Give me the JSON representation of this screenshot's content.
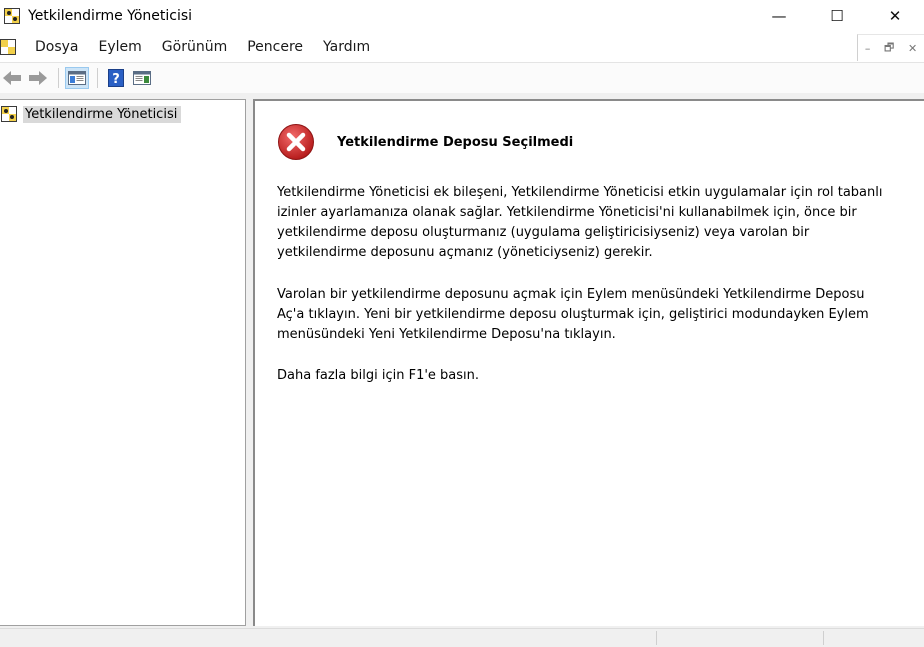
{
  "window": {
    "title": "Yetkilendirme Yöneticisi",
    "controls": {
      "minimize": "—",
      "maximize": "☐",
      "close": "✕"
    }
  },
  "menu": {
    "items": [
      "Dosya",
      "Eylem",
      "Görünüm",
      "Pencere",
      "Yardım"
    ]
  },
  "mdi_controls": {
    "minimize": "–",
    "restore": "🗗",
    "close": "✕"
  },
  "toolbar": {
    "buttons": [
      "back-icon",
      "forward-icon",
      "show-hide-console-tree-icon",
      "help-icon",
      "show-hide-action-pane-icon"
    ]
  },
  "tree": {
    "root_label": "Yetkilendirme Yöneticisi"
  },
  "content": {
    "heading": "Yetkilendirme Deposu Seçilmedi",
    "paragraph1": "Yetkilendirme Yöneticisi ek bileşeni, Yetkilendirme Yöneticisi etkin uygulamalar için rol tabanlı izinler ayarlamanıza olanak sağlar. Yetkilendirme Yöneticisi'ni kullanabilmek için, önce bir yetkilendirme deposu oluşturmanız (uygulama geliştiricisiyseniz) veya varolan bir yetkilendirme deposunu açmanız (yöneticiyseniz) gerekir.",
    "paragraph2": "Varolan bir yetkilendirme deposunu açmak için Eylem menüsündeki Yetkilendirme Deposu Aç'a tıklayın. Yeni bir yetkilendirme deposu oluşturmak için, geliştirici modundayken Eylem menüsündeki Yeni Yetkilendirme Deposu'na tıklayın.",
    "paragraph3": "Daha fazla bilgi için F1'e basın."
  },
  "colors": {
    "error_red": "#d32f2f",
    "selection": "#d9d9d9",
    "accent": "#0078d7"
  }
}
